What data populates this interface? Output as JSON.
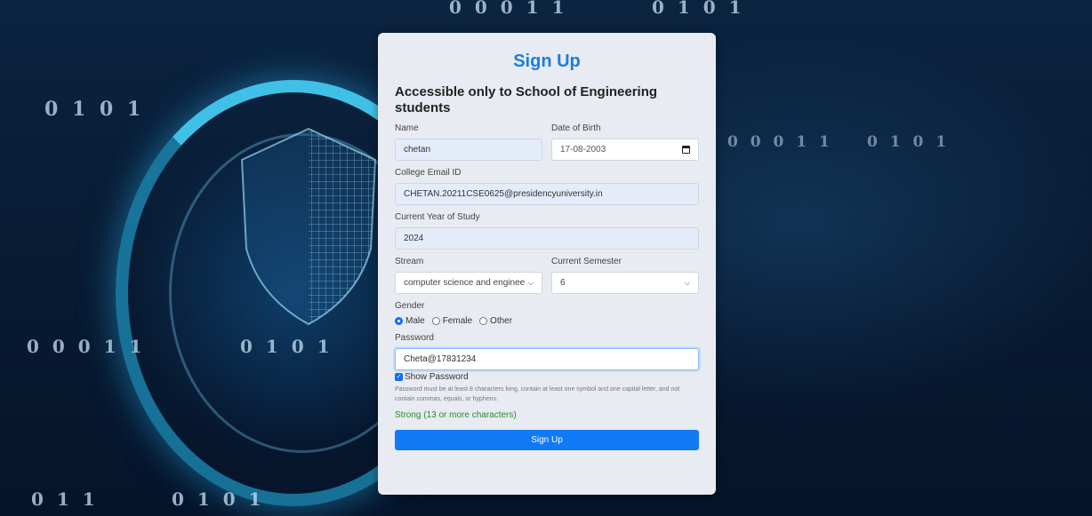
{
  "background": {
    "binary_texts": [
      "0 0   0 1 1",
      "0 1 0 1",
      "0 1   0   1",
      "0 0   0 1 1",
      "0 1 0 1",
      "0 0   0 1 1",
      "0 1 0 1",
      "0 1 1",
      "0 1 0 1"
    ]
  },
  "form": {
    "title": "Sign Up",
    "subtitle": "Accessible only to School of Engineering students",
    "name_label": "Name",
    "name_value": "chetan",
    "dob_label": "Date of Birth",
    "dob_value": "17-08-2003",
    "email_label": "College Email ID",
    "email_value": "CHETAN.20211CSE0625@presidencyuniversity.in",
    "year_label": "Current Year of Study",
    "year_value": "2024",
    "stream_label": "Stream",
    "stream_value": "computer science and enginee",
    "semester_label": "Current Semester",
    "semester_value": "6",
    "gender_label": "Gender",
    "gender_options": [
      "Male",
      "Female",
      "Other"
    ],
    "gender_selected": "Male",
    "password_label": "Password",
    "password_value": "Cheta@17831234",
    "show_password_label": "Show Password",
    "show_password_checked": true,
    "password_help": "Password must be at least 8 characters long, contain at least one symbol and one capital letter, and not contain commas, equals, or hyphens.",
    "strength_text": "Strong (13 or more characters)",
    "submit_label": "Sign Up"
  },
  "colors": {
    "accent": "#1279f5",
    "title": "#1a7ee0",
    "strength": "#2b8a2b"
  }
}
